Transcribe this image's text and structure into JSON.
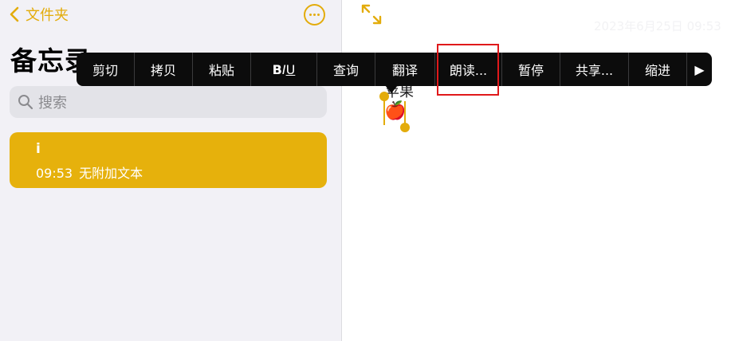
{
  "sidebar": {
    "back_label": "文件夹",
    "title": "备忘录",
    "search_placeholder": "搜索",
    "notes": [
      {
        "title": "i",
        "time": "09:53",
        "preview": "无附加文本"
      }
    ]
  },
  "detail": {
    "date": "2023年6月25日 09:53",
    "text": "苹果",
    "emoji": "🍎"
  },
  "context_menu": {
    "items": [
      "剪切",
      "拷贝",
      "粘贴",
      "BIU",
      "查询",
      "翻译",
      "朗读...",
      "暂停",
      "共享...",
      "缩进"
    ],
    "more_glyph": "▶",
    "highlighted_item": "朗读..."
  },
  "colors": {
    "accent": "#e3ac0b",
    "selected_note": "#e6b10c",
    "menu_bg": "#0c0c0c",
    "highlight_box": "#e0191b"
  }
}
